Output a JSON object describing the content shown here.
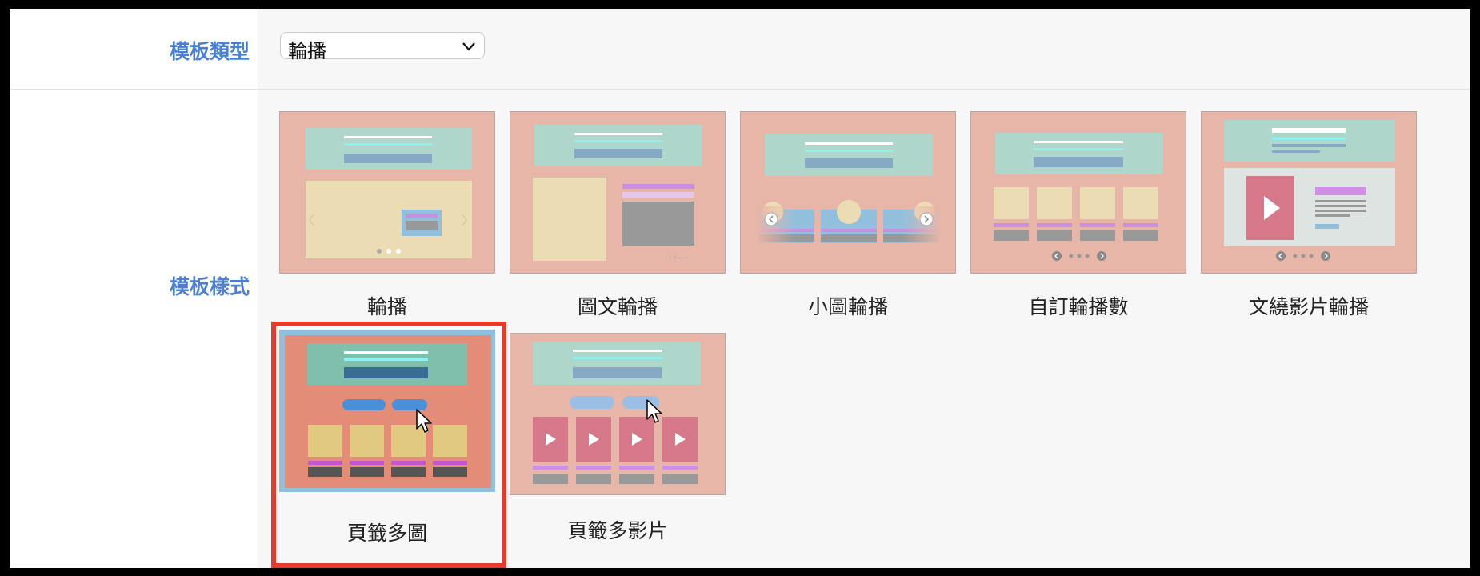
{
  "form": {
    "template_type_label": "模板類型",
    "template_style_label": "模板樣式",
    "template_type_value": "輪播"
  },
  "templates": [
    {
      "label": "輪播",
      "selected": false
    },
    {
      "label": "圖文輪播",
      "selected": false
    },
    {
      "label": "小圖輪播",
      "selected": false
    },
    {
      "label": "自訂輪播數",
      "selected": false
    },
    {
      "label": "文繞影片輪播",
      "selected": false
    },
    {
      "label": "頁籤多圖",
      "selected": true
    },
    {
      "label": "頁籤多影片",
      "selected": false
    }
  ],
  "colors": {
    "label_blue": "#4a7fd4",
    "selection_red": "#e43b2a",
    "thumb_bg": "#e8b6a8"
  }
}
